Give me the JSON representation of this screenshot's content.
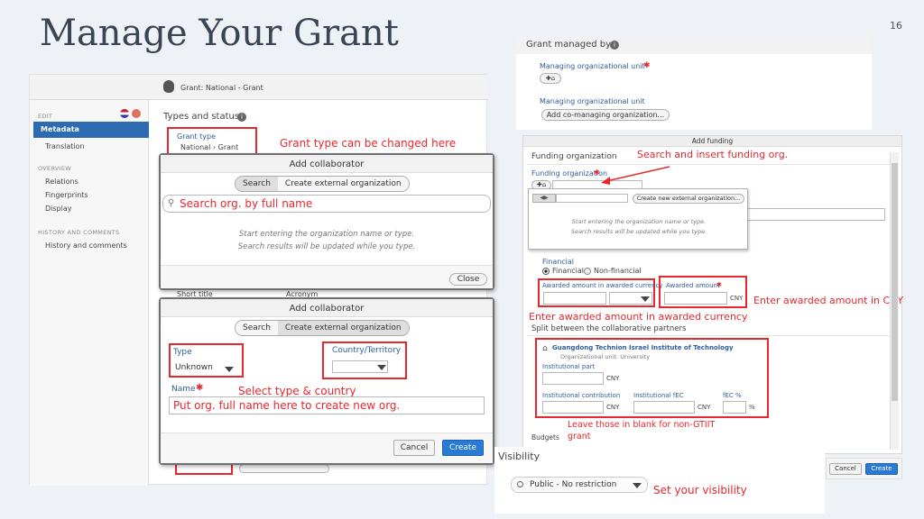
{
  "slide": {
    "title": "Manage Your Grant",
    "page_number": "16"
  },
  "left_screen": {
    "breadcrumb": "Grant: National - Grant",
    "nav": {
      "edit_heading": "EDIT",
      "active_item": "Metadata",
      "items_edit": [
        "Translation"
      ],
      "overview_heading": "OVERVIEW",
      "items_overview": [
        "Relations",
        "Fingerprints",
        "Display"
      ],
      "history_heading": "HISTORY AND COMMENTS",
      "items_history": [
        "History and comments"
      ]
    },
    "types_status_label": "Types and status",
    "grant_type_label": "Grant type",
    "grant_type_value": "National › Grant",
    "short_title_label": "Short title",
    "acronym_label": "Acronym"
  },
  "annotations": {
    "grant_type": "Grant type can be changed here",
    "search_org": "Search org. by full name",
    "select_type_country": "Select type & country",
    "put_org_name": "Put org. full name here to create new org.",
    "search_funding": "Search and insert funding org.",
    "enter_awarded_cny": "Enter awarded amount in CNY",
    "enter_awarded_currency": "Enter awarded amount in awarded currency",
    "leave_blank": "Leave those in blank for non-GTIIT grant",
    "set_visibility": "Set your visibility"
  },
  "collab_dialog_1": {
    "title": "Add collaborator",
    "tab_search": "Search",
    "tab_create": "Create external organization",
    "hint_line1": "Start entering the organization name or type.",
    "hint_line2": "Search results will be updated while you type.",
    "close_label": "Close"
  },
  "collab_dialog_2": {
    "title": "Add collaborator",
    "tab_search": "Search",
    "tab_create": "Create external organization",
    "type_label": "Type",
    "type_value": "Unknown",
    "country_label": "Country/Territory",
    "name_label": "Name",
    "cancel_label": "Cancel",
    "create_label": "Create"
  },
  "grant_managed": {
    "heading": "Grant managed by",
    "managing_unit_label": "Managing organizational unit",
    "managing_unit_label_2": "Managing organizational unit",
    "add_co_managing": "Add co-managing organization..."
  },
  "funding_dialog": {
    "title": "Add funding",
    "section_label": "Funding organization",
    "field_label": "Funding organization",
    "create_new_ext": "Create new external organization...",
    "hint_line1": "Start entering the organization name or type.",
    "hint_line2": "Search results will be updated while you type.",
    "financial_label": "Financial",
    "option_financial": "Financial",
    "option_non_financial": "Non-financial",
    "awarded_currency_label": "Awarded amount in awarded currency",
    "awarded_amount_label": "Awarded amount",
    "cny": "CNY",
    "split_label": "Split between the collaborative partners",
    "institute_name": "Guangdong Technion Israel Institute of Technology",
    "institute_unit": "Organizational unit: University",
    "institutional_part": "Institutional part",
    "institutional_contribution": "Institutional contribution",
    "institutional_fec": "Institutional fEC",
    "fec_percent": "fEC %",
    "percent_sign": "%",
    "budgets_label": "Budgets",
    "cancel_label": "Cancel",
    "create_label": "Create"
  },
  "visibility": {
    "heading": "Visibility",
    "value": "Public - No restriction"
  },
  "colors": {
    "annotation_red": "#e8262d",
    "link_blue": "#2f5d9b",
    "primary_button": "#2a7ad5",
    "nav_active": "#2d6bb3"
  }
}
